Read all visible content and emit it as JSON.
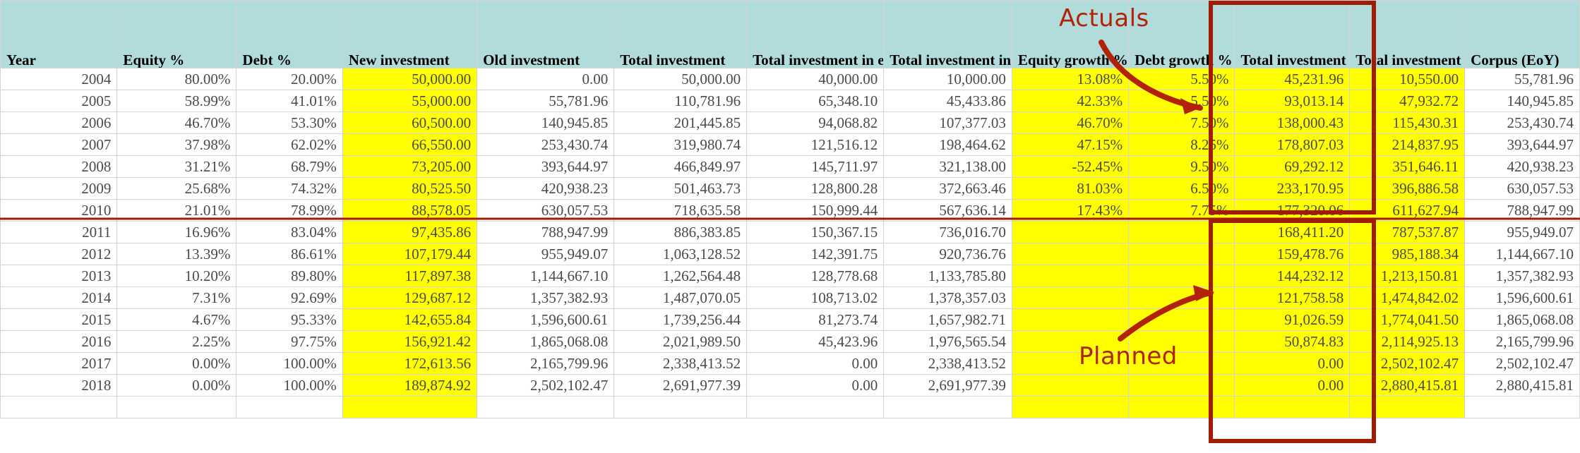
{
  "sheet": {
    "columns": [
      {
        "key": "year",
        "label": "Year",
        "cls": "c-year"
      },
      {
        "key": "eqp",
        "label": "Equity %",
        "cls": "c-eqp"
      },
      {
        "key": "dbp",
        "label": "Debt %",
        "cls": "c-dbp"
      },
      {
        "key": "newinv",
        "label": "New investment",
        "cls": "c-newinv",
        "highlight": true
      },
      {
        "key": "oldinv",
        "label": "Old investment",
        "cls": "c-oldinv"
      },
      {
        "key": "totinv",
        "label": "Total investment",
        "cls": "c-totinv"
      },
      {
        "key": "teboy",
        "label": "Total investment in equity (BoY)",
        "cls": "c-teboy"
      },
      {
        "key": "tdboy",
        "label": "Total investment in debt (BoY)",
        "cls": "c-tdboy"
      },
      {
        "key": "eqg",
        "label": "Equity growth %",
        "cls": "c-eqg",
        "highlight": true
      },
      {
        "key": "dbg",
        "label": "Debt growth %",
        "cls": "c-dbg",
        "highlight": true
      },
      {
        "key": "teeoy",
        "label": "Total investment in equity after growth (EoY)",
        "cls": "c-teeoy",
        "highlight": true
      },
      {
        "key": "tdeoy",
        "label": "Total investment in debt after growth (EoY)",
        "cls": "c-tdeoy",
        "highlight": true
      },
      {
        "key": "corpus",
        "label": "Corpus (EoY)",
        "cls": "c-corpus"
      }
    ],
    "rows": [
      {
        "year": "2004",
        "eqp": "80.00%",
        "dbp": "20.00%",
        "newinv": "50,000.00",
        "oldinv": "0.00",
        "totinv": "50,000.00",
        "teboy": "40,000.00",
        "tdboy": "10,000.00",
        "eqg": "13.08%",
        "dbg": "5.50%",
        "teeoy": "45,231.96",
        "tdeoy": "10,550.00",
        "corpus": "55,781.96"
      },
      {
        "year": "2005",
        "eqp": "58.99%",
        "dbp": "41.01%",
        "newinv": "55,000.00",
        "oldinv": "55,781.96",
        "totinv": "110,781.96",
        "teboy": "65,348.10",
        "tdboy": "45,433.86",
        "eqg": "42.33%",
        "dbg": "5.50%",
        "teeoy": "93,013.14",
        "tdeoy": "47,932.72",
        "corpus": "140,945.85"
      },
      {
        "year": "2006",
        "eqp": "46.70%",
        "dbp": "53.30%",
        "newinv": "60,500.00",
        "oldinv": "140,945.85",
        "totinv": "201,445.85",
        "teboy": "94,068.82",
        "tdboy": "107,377.03",
        "eqg": "46.70%",
        "dbg": "7.50%",
        "teeoy": "138,000.43",
        "tdeoy": "115,430.31",
        "corpus": "253,430.74"
      },
      {
        "year": "2007",
        "eqp": "37.98%",
        "dbp": "62.02%",
        "newinv": "66,550.00",
        "oldinv": "253,430.74",
        "totinv": "319,980.74",
        "teboy": "121,516.12",
        "tdboy": "198,464.62",
        "eqg": "47.15%",
        "dbg": "8.25%",
        "teeoy": "178,807.03",
        "tdeoy": "214,837.95",
        "corpus": "393,644.97"
      },
      {
        "year": "2008",
        "eqp": "31.21%",
        "dbp": "68.79%",
        "newinv": "73,205.00",
        "oldinv": "393,644.97",
        "totinv": "466,849.97",
        "teboy": "145,711.97",
        "tdboy": "321,138.00",
        "eqg": "-52.45%",
        "dbg": "9.50%",
        "teeoy": "69,292.12",
        "tdeoy": "351,646.11",
        "corpus": "420,938.23"
      },
      {
        "year": "2009",
        "eqp": "25.68%",
        "dbp": "74.32%",
        "newinv": "80,525.50",
        "oldinv": "420,938.23",
        "totinv": "501,463.73",
        "teboy": "128,800.28",
        "tdboy": "372,663.46",
        "eqg": "81.03%",
        "dbg": "6.50%",
        "teeoy": "233,170.95",
        "tdeoy": "396,886.58",
        "corpus": "630,057.53"
      },
      {
        "year": "2010",
        "eqp": "21.01%",
        "dbp": "78.99%",
        "newinv": "88,578.05",
        "oldinv": "630,057.53",
        "totinv": "718,635.58",
        "teboy": "150,999.44",
        "tdboy": "567,636.14",
        "eqg": "17.43%",
        "dbg": "7.75%",
        "teeoy": "177,320.06",
        "tdeoy": "611,627.94",
        "corpus": "788,947.99"
      },
      {
        "year": "2011",
        "eqp": "16.96%",
        "dbp": "83.04%",
        "newinv": "97,435.86",
        "oldinv": "788,947.99",
        "totinv": "886,383.85",
        "teboy": "150,367.15",
        "tdboy": "736,016.70",
        "eqg": "",
        "dbg": "",
        "teeoy": "168,411.20",
        "tdeoy": "787,537.87",
        "corpus": "955,949.07"
      },
      {
        "year": "2012",
        "eqp": "13.39%",
        "dbp": "86.61%",
        "newinv": "107,179.44",
        "oldinv": "955,949.07",
        "totinv": "1,063,128.52",
        "teboy": "142,391.75",
        "tdboy": "920,736.76",
        "eqg": "",
        "dbg": "",
        "teeoy": "159,478.76",
        "tdeoy": "985,188.34",
        "corpus": "1,144,667.10"
      },
      {
        "year": "2013",
        "eqp": "10.20%",
        "dbp": "89.80%",
        "newinv": "117,897.38",
        "oldinv": "1,144,667.10",
        "totinv": "1,262,564.48",
        "teboy": "128,778.68",
        "tdboy": "1,133,785.80",
        "eqg": "",
        "dbg": "",
        "teeoy": "144,232.12",
        "tdeoy": "1,213,150.81",
        "corpus": "1,357,382.93"
      },
      {
        "year": "2014",
        "eqp": "7.31%",
        "dbp": "92.69%",
        "newinv": "129,687.12",
        "oldinv": "1,357,382.93",
        "totinv": "1,487,070.05",
        "teboy": "108,713.02",
        "tdboy": "1,378,357.03",
        "eqg": "",
        "dbg": "",
        "teeoy": "121,758.58",
        "tdeoy": "1,474,842.02",
        "corpus": "1,596,600.61"
      },
      {
        "year": "2015",
        "eqp": "4.67%",
        "dbp": "95.33%",
        "newinv": "142,655.84",
        "oldinv": "1,596,600.61",
        "totinv": "1,739,256.44",
        "teboy": "81,273.74",
        "tdboy": "1,657,982.71",
        "eqg": "",
        "dbg": "",
        "teeoy": "91,026.59",
        "tdeoy": "1,774,041.50",
        "corpus": "1,865,068.08"
      },
      {
        "year": "2016",
        "eqp": "2.25%",
        "dbp": "97.75%",
        "newinv": "156,921.42",
        "oldinv": "1,865,068.08",
        "totinv": "2,021,989.50",
        "teboy": "45,423.96",
        "tdboy": "1,976,565.54",
        "eqg": "",
        "dbg": "",
        "teeoy": "50,874.83",
        "tdeoy": "2,114,925.13",
        "corpus": "2,165,799.96"
      },
      {
        "year": "2017",
        "eqp": "0.00%",
        "dbp": "100.00%",
        "newinv": "172,613.56",
        "oldinv": "2,165,799.96",
        "totinv": "2,338,413.52",
        "teboy": "0.00",
        "tdboy": "2,338,413.52",
        "eqg": "",
        "dbg": "",
        "teeoy": "0.00",
        "tdeoy": "2,502,102.47",
        "corpus": "2,502,102.47"
      },
      {
        "year": "2018",
        "eqp": "0.00%",
        "dbp": "100.00%",
        "newinv": "189,874.92",
        "oldinv": "2,502,102.47",
        "totinv": "2,691,977.39",
        "teboy": "0.00",
        "tdboy": "2,691,977.39",
        "eqg": "",
        "dbg": "",
        "teeoy": "0.00",
        "tdeoy": "2,880,415.81",
        "corpus": "2,880,415.81"
      },
      {
        "year": "",
        "eqp": "",
        "dbp": "",
        "newinv": "",
        "oldinv": "",
        "totinv": "",
        "teboy": "",
        "tdboy": "",
        "eqg": "",
        "dbg": "",
        "teeoy": "",
        "tdeoy": "",
        "corpus": ""
      }
    ]
  },
  "annotations": {
    "actuals_label": "Actuals",
    "planned_label": "Planned",
    "accent_color": "#b22207",
    "header_fill": "#b2dcdc",
    "highlight_fill": "#ffff00"
  }
}
